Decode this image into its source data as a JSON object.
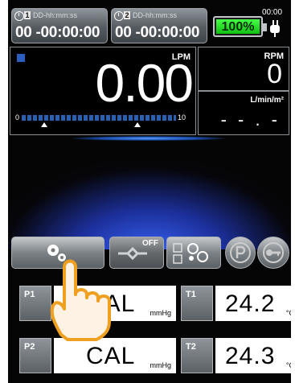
{
  "timers": [
    {
      "num": "1",
      "format": "DD-hh:mm:ss",
      "value": "00 -00:00:00"
    },
    {
      "num": "2",
      "format": "DD-hh:mm:ss",
      "value": "00 -00:00:00"
    }
  ],
  "battery": {
    "percent_label": "100%",
    "level": 1.0
  },
  "clock": "00:00",
  "flow": {
    "unit": "LPM",
    "value": "0.00",
    "scale_min": "0",
    "scale_max": "10"
  },
  "rpm": {
    "label": "RPM",
    "value": "0"
  },
  "index": {
    "label": "L/min/m²",
    "value": "- - . -"
  },
  "buttons": {
    "bypass_state": "OFF"
  },
  "pressure": [
    {
      "label": "P1",
      "value": "CAL",
      "unit": "mmHg"
    },
    {
      "label": "P2",
      "value": "CAL",
      "unit": "mmHg"
    }
  ],
  "temperature": [
    {
      "label": "T1",
      "value": "24.2",
      "unit": "°C"
    },
    {
      "label": "T2",
      "value": "24.3",
      "unit": "°C"
    }
  ],
  "colors": {
    "accent": "#2b5fb0",
    "battery": "#22d022",
    "glow": "#3968ff"
  }
}
